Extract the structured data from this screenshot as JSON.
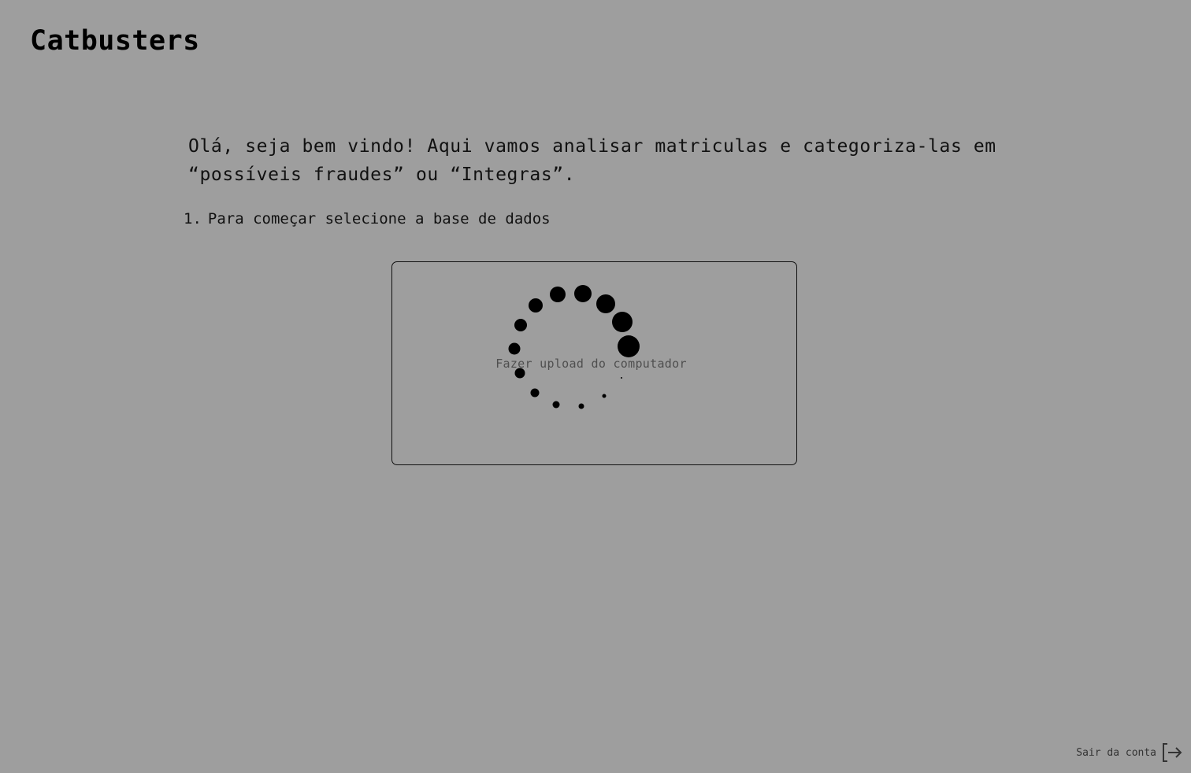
{
  "app": {
    "title": "Catbusters"
  },
  "intro": {
    "text": "Olá, seja bem vindo! Aqui vamos analisar matriculas e categoriza-las em “possíveis fraudes” ou “Integras”."
  },
  "steps": [
    {
      "number": "1.",
      "label": "Para começar selecione a base de dados"
    }
  ],
  "upload": {
    "label": "Fazer upload do computador",
    "loading_icon": "loading-spinner-icon"
  },
  "footer": {
    "logout_label": "Sair da conta",
    "logout_icon": "logout-arrow-icon"
  }
}
